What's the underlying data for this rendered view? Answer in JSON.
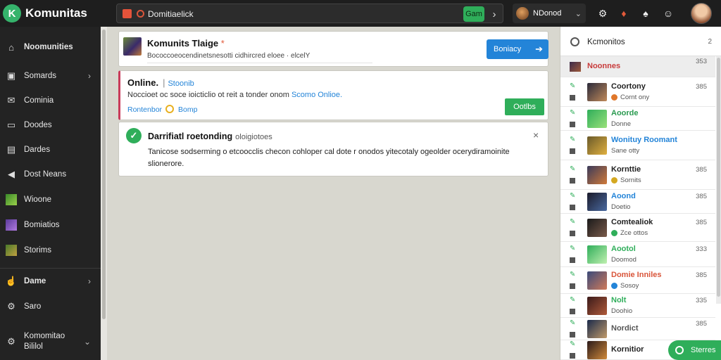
{
  "app": {
    "logo_letter": "K",
    "title": "Komunitas"
  },
  "search": {
    "value": "Domitiaelick",
    "button": "Gam",
    "chevron": "›"
  },
  "user": {
    "name": "NDonod"
  },
  "top_icons": [
    "settings-icon",
    "alert-icon",
    "spade-icon",
    "emoji-icon"
  ],
  "sidebar": {
    "items": [
      {
        "label": "Noomunities",
        "icon": "home-icon",
        "chevron": false
      },
      {
        "label": "Somards",
        "icon": "bag-icon",
        "chevron": true
      },
      {
        "label": "Cominia",
        "icon": "mail-icon",
        "chevron": false
      },
      {
        "label": "Doodes",
        "icon": "folder-icon",
        "chevron": false
      },
      {
        "label": "Dardes",
        "icon": "card-icon",
        "chevron": false
      },
      {
        "label": "Dost Neans",
        "icon": "megaphone-icon",
        "chevron": false
      },
      {
        "label": "Wioone",
        "icon": "game-icon",
        "chevron": false
      },
      {
        "label": "Bomiatios",
        "icon": "game-icon",
        "chevron": false
      },
      {
        "label": "Storims",
        "icon": "game-icon",
        "chevron": false
      },
      {
        "label": "Dame",
        "icon": "thumb-icon",
        "chevron": true
      },
      {
        "label": "Saro",
        "icon": "gear-icon",
        "chevron": false
      },
      {
        "label": "Komomitao\nBililol",
        "icon": "gear-icon",
        "chevron": true
      }
    ]
  },
  "card1": {
    "title": "Komunits Tlaige",
    "star": "*",
    "subtitle": "Bococcoeocendinetsnesotti cidhircred eloee · elcelY",
    "button": "Boniacy"
  },
  "card2": {
    "title": "Online.",
    "separator": "|",
    "link": "Stoonib",
    "description": "Noccioet oc soce ioicticlio ot reit a tonder onom",
    "description_link": "Scomo Onlioe.",
    "meta_left": "Rontenbor",
    "meta_right": "Bomp",
    "button": "Ootlbs"
  },
  "card3": {
    "title": "Darrifiatl roetonding",
    "title_sub": "oloigiotoes",
    "close": "×",
    "body": "Tanicose sodserming o etcoocclis checon cohloper cal dote r onodos yitecotaly ogeolder ocerydiramoinite slionerore."
  },
  "right_panel": {
    "title": "Kcmonitos",
    "count": "2",
    "rows": [
      {
        "name": "Noonnes",
        "sub": "",
        "num": "353",
        "accent": "#c83a3a",
        "sub_badge": "",
        "first": true
      },
      {
        "name": "Coortony",
        "sub": "Cornt ony",
        "num": "385",
        "accent": "#222",
        "sub_badge": "#e0772a"
      },
      {
        "name": "Aoorde",
        "sub": "Donne",
        "num": "",
        "accent": "#2a9a50",
        "sub_badge": ""
      },
      {
        "name": "Wonituy Roomant",
        "sub": "Sane otty",
        "num": "",
        "accent": "#2384d8",
        "sub_badge": ""
      },
      {
        "name": "Kornttie",
        "sub": "Sornits",
        "num": "385",
        "accent": "#222",
        "sub_badge": "#d4a820"
      },
      {
        "name": "Aoond",
        "sub": "Doetio",
        "num": "385",
        "accent": "#2384d8",
        "sub_badge": ""
      },
      {
        "name": "Comtealiok",
        "sub": "Zce ottos",
        "num": "385",
        "accent": "#222",
        "sub_badge": "#2fae5a"
      },
      {
        "name": "Aootol",
        "sub": "Doomod",
        "num": "333",
        "accent": "#2fae5a",
        "sub_badge": ""
      },
      {
        "name": "Domie Inniles",
        "sub": "Sosoy",
        "num": "385",
        "accent": "#d9553a",
        "sub_badge": "#2384d8"
      },
      {
        "name": "Nolt",
        "sub": "Doohio",
        "num": "335",
        "accent": "#2fae5a",
        "sub_badge": ""
      },
      {
        "name": "Nordict",
        "sub": "",
        "num": "385",
        "accent": "#555",
        "sub_badge": ""
      },
      {
        "name": "Kornitior",
        "sub": "",
        "num": "",
        "accent": "#222",
        "sub_badge": ""
      }
    ]
  },
  "status": {
    "label": "Sterres"
  }
}
